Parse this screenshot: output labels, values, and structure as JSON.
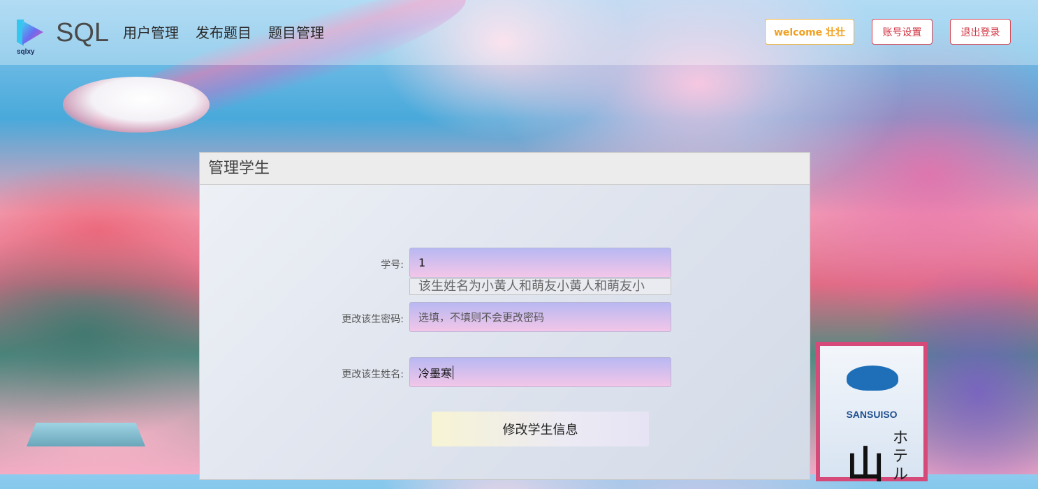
{
  "header": {
    "logo_sub": "sqlxy",
    "brand": "SQL",
    "nav": [
      "用户管理",
      "发布题目",
      "题目管理"
    ],
    "welcome": "welcome 壮壮",
    "account_settings": "账号设置",
    "logout": "退出登录"
  },
  "background_sign": {
    "brand": "SANSUISO",
    "kana": "ホテル",
    "big_char": "山"
  },
  "panel": {
    "title": "管理学生",
    "student_id_label": "学号:",
    "student_id_value": "1",
    "name_hint": "该生姓名为小黄人和萌友小黄人和萌友小",
    "password_label": "更改该生密码:",
    "password_placeholder": "选填，不填则不会更改密码",
    "name_label": "更改该生姓名:",
    "name_value": "冷墨寒",
    "submit_label": "修改学生信息"
  },
  "colors": {
    "welcome_accent": "#f0a020",
    "danger_accent": "#d0313f"
  },
  "icons": {
    "logo": "sqlxy-play-logo-icon"
  }
}
